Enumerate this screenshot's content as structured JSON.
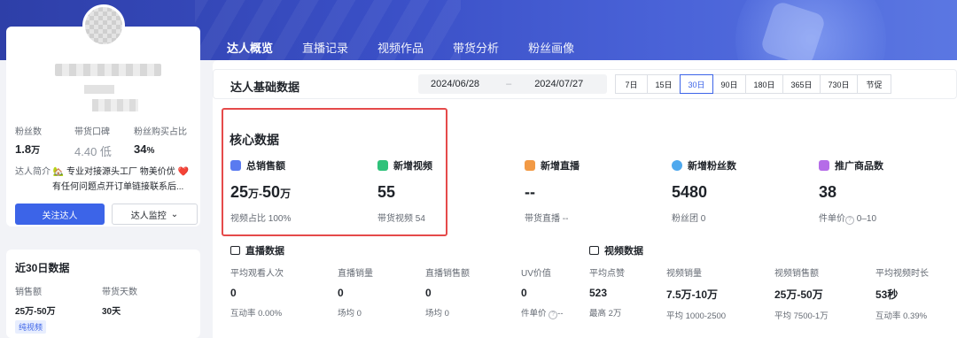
{
  "tabs": [
    "达人概览",
    "直播记录",
    "视频作品",
    "带货分析",
    "粉丝画像"
  ],
  "profile": {
    "stats": [
      {
        "label": "粉丝数",
        "value": "1.8",
        "unit": "万"
      },
      {
        "label": "带货口碑",
        "value": "4.40 低",
        "unit": ""
      },
      {
        "label": "粉丝购买占比",
        "value": "34",
        "unit": "%"
      }
    ],
    "intro_label": "达人简介",
    "intro_line1": "🏡 专业对接源头工厂 物美价优 ❤️",
    "intro_line2": "有任何问题点开订单链接联系后...",
    "follow_button": "关注达人",
    "monitor_button": "达人监控",
    "monitor_chevron": "⌄"
  },
  "recent": {
    "title": "近30日数据",
    "items": [
      {
        "label": "销售额",
        "value": "25万-50万",
        "tag": "纯视频"
      },
      {
        "label": "带货天数",
        "value": "30天"
      }
    ]
  },
  "toolbar": {
    "title": "达人基础数据",
    "date_start": "2024/06/28",
    "date_sep": "–",
    "date_end": "2024/07/27",
    "ranges": [
      "7日",
      "15日",
      "30日",
      "90日",
      "180日",
      "365日",
      "730日",
      "节促"
    ],
    "active_range": "30日"
  },
  "core": {
    "title": "核心数据",
    "metrics": [
      {
        "icon": "sales-icon",
        "color": "#5a7bf0",
        "label": "总销售额",
        "value": "25",
        "value2": "50",
        "unit": "万",
        "sep": "-",
        "sub": "视频占比 100%"
      },
      {
        "icon": "video-icon",
        "color": "#2fc27a",
        "label": "新增视频",
        "value": "55",
        "sub": "带货视频 54"
      },
      {
        "icon": "live-icon",
        "color": "#f29a45",
        "label": "新增直播",
        "value": "--",
        "sub": "带货直播 --"
      },
      {
        "icon": "fans-icon",
        "color": "#4fa9ee",
        "label": "新增粉丝数",
        "value": "5480",
        "sub": "粉丝团 0"
      },
      {
        "icon": "product-icon",
        "color": "#b56ce8",
        "label": "推广商品数",
        "value": "38",
        "sub": "件单价",
        "sub2": "0–10"
      }
    ]
  },
  "live": {
    "title": "直播数据",
    "stats": [
      {
        "label": "平均观看人次",
        "value": "0",
        "sub": "互动率 0.00%"
      },
      {
        "label": "直播销量",
        "value": "0",
        "sub": "场均 0"
      },
      {
        "label": "直播销售额",
        "value": "0",
        "sub": "场均 0"
      },
      {
        "label": "UV价值",
        "value": "0",
        "sub": "件单价",
        "sub2": "--"
      }
    ]
  },
  "video": {
    "title": "视频数据",
    "stats": [
      {
        "label": "平均点赞",
        "value": "523",
        "sub": "最高 2万"
      },
      {
        "label": "视频销量",
        "value": "7.5万-10万",
        "sub": "平均 1000-2500"
      },
      {
        "label": "视频销售额",
        "value": "25万-50万",
        "sub": "平均 7500-1万"
      },
      {
        "label": "平均视频时长",
        "value": "53秒",
        "sub": "互动率 0.39%"
      }
    ]
  }
}
